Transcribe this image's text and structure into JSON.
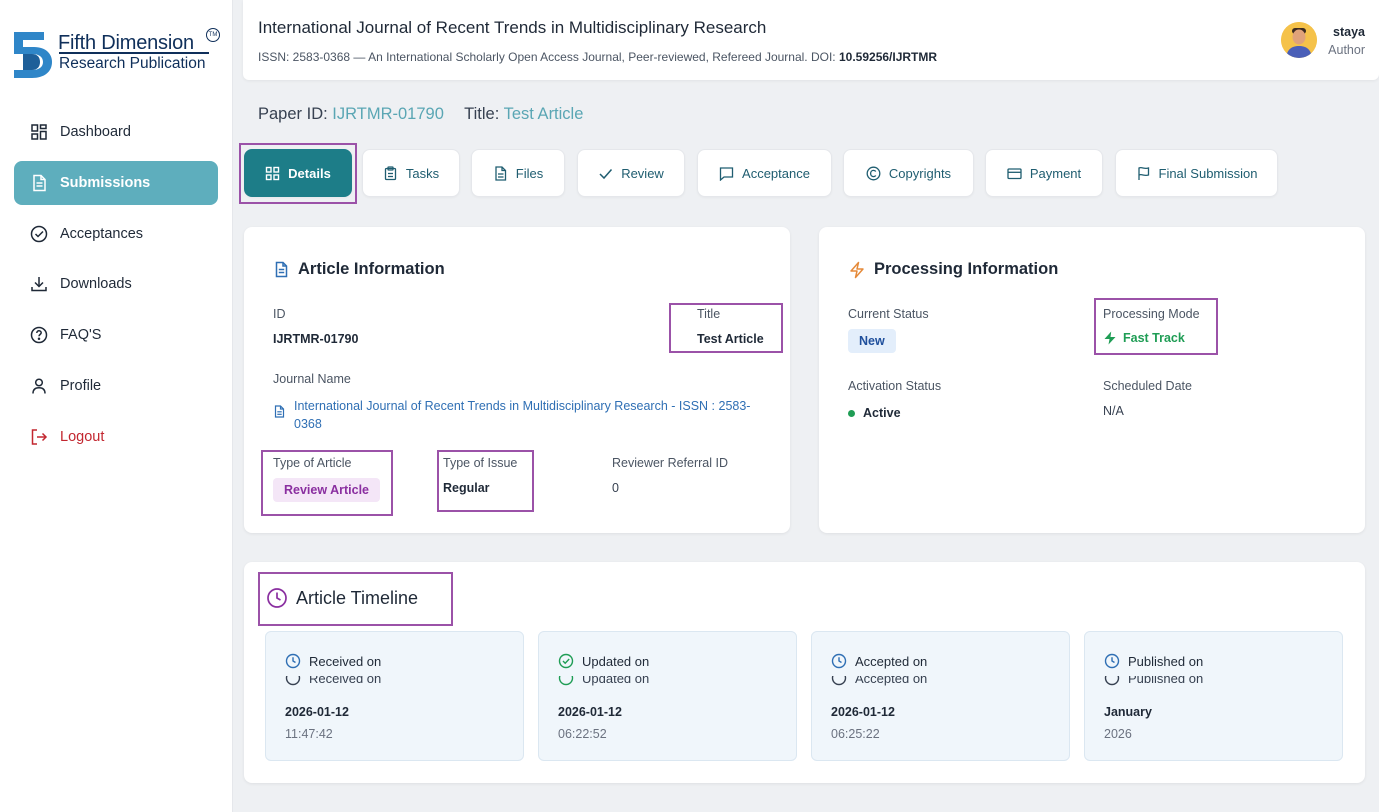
{
  "brand": {
    "line1": "Fifth Dimension",
    "line2": "Research Publication",
    "tm": "TM"
  },
  "sidebar": {
    "items": [
      {
        "label": "Dashboard",
        "icon": "dashboard-grid-icon"
      },
      {
        "label": "Submissions",
        "icon": "document-icon",
        "active": true
      },
      {
        "label": "Acceptances",
        "icon": "check-circle-icon"
      },
      {
        "label": "Downloads",
        "icon": "download-icon"
      },
      {
        "label": "FAQ'S",
        "icon": "question-circle-icon"
      },
      {
        "label": "Profile",
        "icon": "user-icon"
      },
      {
        "label": "Logout",
        "icon": "logout-icon"
      }
    ]
  },
  "header": {
    "title": "International Journal of Recent Trends in Multidisciplinary Research",
    "subtitle": "ISSN: 2583-0368 — An International Scholarly Open Access Journal, Peer-reviewed, Refereed Journal. DOI: ",
    "doi": "10.59256/IJRTMR",
    "user_name": "staya",
    "user_role": "Author"
  },
  "paper": {
    "id_label": "Paper ID:",
    "id_value": "IJRTMR-01790",
    "title_label": "Title:",
    "title_value": "Test Article"
  },
  "tabs": [
    {
      "label": "Details",
      "icon": "grid-icon",
      "active": true
    },
    {
      "label": "Tasks",
      "icon": "clipboard-icon"
    },
    {
      "label": "Files",
      "icon": "file-icon"
    },
    {
      "label": "Review",
      "icon": "check-icon"
    },
    {
      "label": "Acceptance",
      "icon": "message-icon"
    },
    {
      "label": "Copyrights",
      "icon": "copyright-icon"
    },
    {
      "label": "Payment",
      "icon": "card-icon"
    },
    {
      "label": "Final Submission",
      "icon": "flag-icon"
    }
  ],
  "article_info": {
    "title": "Article Information",
    "id_label": "ID",
    "id_value": "IJRTMR-01790",
    "title_label": "Title",
    "title_value": "Test Article",
    "journal_label": "Journal Name",
    "journal_value_line1": "International Journal of Recent Trends in Multidisciplinary Research - ISSN : 2583-",
    "journal_value_line2": "0368",
    "type_article_label": "Type of Article",
    "type_article_value": "Review Article",
    "type_issue_label": "Type of Issue",
    "type_issue_value": "Regular",
    "reviewer_label": "Reviewer Referral ID",
    "reviewer_value": "0"
  },
  "processing_info": {
    "title": "Processing Information",
    "status_label": "Current Status",
    "status_value": "New",
    "mode_label": "Processing Mode",
    "mode_value": "Fast Track",
    "activation_label": "Activation Status",
    "activation_value": "Active",
    "scheduled_label": "Scheduled Date",
    "scheduled_value": "N/A"
  },
  "timeline": {
    "title": "Article Timeline",
    "items": [
      {
        "label": "Received on",
        "date": "2026-01-12",
        "time": "11:47:42",
        "icon": "clock-icon"
      },
      {
        "label": "Updated on",
        "date": "2026-01-12",
        "time": "06:22:52",
        "icon": "check-circle-icon"
      },
      {
        "label": "Accepted on",
        "date": "2026-01-12",
        "time": "06:25:22",
        "icon": "clock-icon"
      },
      {
        "label": "Published on",
        "date": "January",
        "time": "2026",
        "icon": "clock-icon"
      }
    ]
  },
  "colors": {
    "accent": "#5eaebd",
    "tab_active": "#1d7d88",
    "highlight": "#9b52a8",
    "logout": "#c2262f",
    "fast_track": "#1f9d55"
  }
}
